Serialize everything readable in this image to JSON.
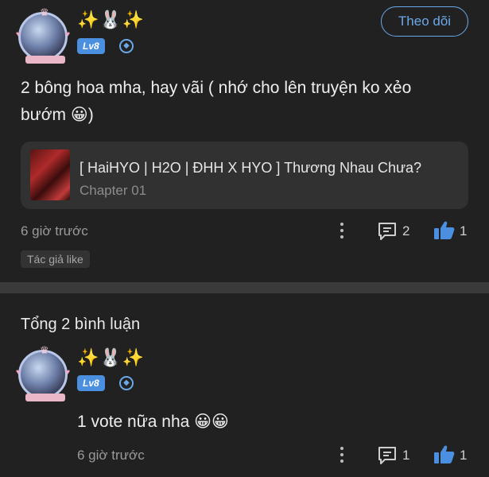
{
  "post": {
    "username": "✨🐰✨",
    "level": "Lv8",
    "follow_label": "Theo dõi",
    "text_line1": "2 bông hoa mha, hay vãi ( nhớ cho lên truyện ko xẻo",
    "text_line2": "bướm 😀)",
    "story": {
      "title": "[ HaiHYO | H2O | ĐHH X HYO ] Thương Nhau Chưa?",
      "chapter": "Chapter 01"
    },
    "time": "6 giờ trước",
    "reply_count": "2",
    "like_count": "1",
    "author_like": "Tác giả like"
  },
  "comments_header": "Tổng 2 bình luận",
  "reply": {
    "username": "✨🐰✨",
    "level": "Lv8",
    "text": "1 vote nữa nha 😀😀",
    "time": "6 giờ trước",
    "reply_count": "1",
    "like_count": "1"
  },
  "colors": {
    "background": "#212121",
    "accent": "#4b8fe0",
    "card": "#313131"
  },
  "icons": [
    "more-vertical-icon",
    "comment-icon",
    "thumbs-up-icon",
    "verified-badge-icon"
  ]
}
